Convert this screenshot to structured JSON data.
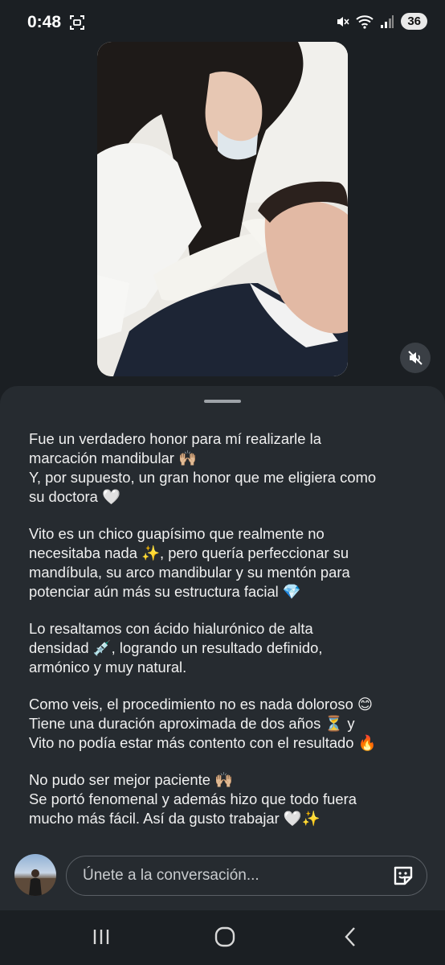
{
  "status_bar": {
    "time": "0:48",
    "battery": "36"
  },
  "post": {
    "caption_paragraphs": [
      [
        "Fue un verdadero honor para mí realizarle la",
        "marcación mandibular 🙌🏼",
        "Y, por supuesto, un gran honor que me eligiera como",
        "su doctora 🤍"
      ],
      [
        "Vito es un chico guapísimo que realmente no",
        "necesitaba nada ✨, pero quería perfeccionar su",
        "mandíbula, su arco mandibular y su mentón para",
        "potenciar aún más su estructura facial 💎"
      ],
      [
        "Lo resaltamos con ácido hialurónico de alta",
        "densidad 💉, logrando un resultado definido,",
        "armónico y muy natural."
      ],
      [
        "Como veis, el procedimiento no es nada doloroso 😊",
        "Tiene una duración aproximada de dos años ⏳ y",
        "Vito no podía estar más contento con el resultado 🔥"
      ],
      [
        "No pudo ser mejor paciente 🙌🏼",
        "Se portó fenomenal y además hizo que todo fuera",
        "mucho más fácil. Así da gusto trabajar 🤍✨"
      ]
    ]
  },
  "composer": {
    "placeholder": "Únete a la conversación..."
  },
  "icons": {
    "screen_record": "screen-record-icon",
    "mute": "mute-icon",
    "sticker": "sticker-icon",
    "nav_recents": "recents-icon",
    "nav_home": "home-icon",
    "nav_back": "back-icon"
  },
  "colors": {
    "background": "#1b1f23",
    "sheet": "#262b30",
    "text": "#f0f0f0"
  }
}
